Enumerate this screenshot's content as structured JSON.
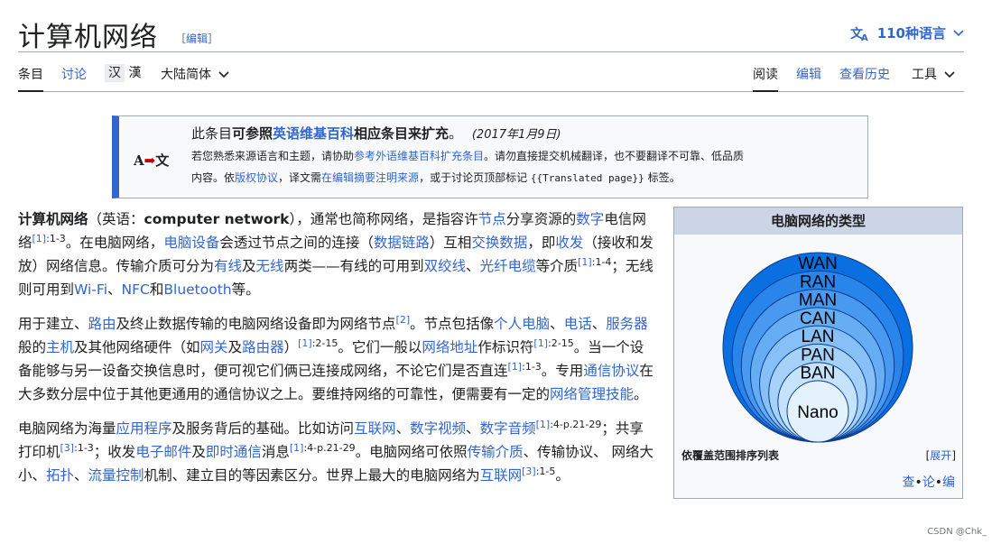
{
  "header": {
    "title": "计算机网络",
    "edit_open": "［",
    "edit_label": "编辑",
    "edit_close": "］",
    "languages": "110种语言"
  },
  "tabs": {
    "article": "条目",
    "talk": "讨论",
    "variant_trad": "汉",
    "variant_simp": "漢",
    "variant_select": "大陆简体",
    "read": "阅读",
    "edit": "编辑",
    "history": "查看历史",
    "tools": "工具"
  },
  "notice": {
    "icon": "A➡文",
    "l1_a": "此条目",
    "l1_b": "可参照",
    "l1_link": "英语维基百科",
    "l1_c": "相应条目来扩充",
    "l1_d": "。",
    "l1_date": "(2017年1月9日)",
    "l2_a": "若您熟悉来源语言和主题，请协助",
    "l2_link": "参考外语维基百科扩充条目",
    "l2_b": "。请勿直接提交机械翻译，也不要翻译不可靠、低品质",
    "l3_a": "内容。依",
    "l3_link1": "版权协议",
    "l3_b": "，译文需",
    "l3_link2": "在编辑摘要注明来源",
    "l3_c": "，或于讨论页顶部标记",
    "l3_code": "{{Translated page}}",
    "l3_d": "标签。"
  },
  "p1": {
    "t1": "计算机网络",
    "t2": "（英语：",
    "t3": "computer network",
    "t4": "），通常也简称网络，是指容许",
    "l1": "节点",
    "t5": "分享资源的",
    "l2": "数字",
    "t6": "电信网络",
    "s1": "[1]",
    "r1": ":1-3",
    "t7": "。在电脑网络，",
    "l3": "电脑设备",
    "t8": "会透过节点之间的连接（",
    "l4": "数据链路",
    "t9": "）互相",
    "l5": "交换数据",
    "t10": "，即",
    "l6": "收发",
    "t11": "（接收和发放）网络信息。传输介质可分为",
    "l7": "有线",
    "t12": "及",
    "l8": "无线",
    "t13": "两类——有线的可用到",
    "l9": "双绞线",
    "t14": "、",
    "l10": "光纤电缆",
    "t15": "等介质",
    "s2": "[1]",
    "r2": ":1-4",
    "t16": "；无线则可用到",
    "l11": "Wi-Fi",
    "t17": "、",
    "l12": "NFC",
    "t18": "和",
    "l13": "Bluetooth",
    "t19": "等。"
  },
  "p2": {
    "t1": "用于建立、",
    "l1": "路由",
    "t2": "及终止数据传输的电脑网络设备即为网络节点",
    "s1": "[2]",
    "t3": "。节点包括像",
    "l2": "个人电脑",
    "t4": "、",
    "l3": "电话",
    "t5": "、",
    "l4": "服务器",
    "t6": "般的",
    "l5": "主机",
    "t7": "及其他网络硬件（如",
    "l6": "网关",
    "t8": "及",
    "l7": "路由器",
    "t9": "）",
    "s2": "[1]",
    "r2": ":2-15",
    "t10": "。它们一般以",
    "l8": "网络地址",
    "t11": "作标识符",
    "s3": "[1]",
    "r3": ":2-15",
    "t12": "。当一个设备能够与另一设备交换信息时，便可视它们俩已连接成网络，不论它们是否直连",
    "s4": "[1]",
    "r4": ":1-3",
    "t13": "。专用",
    "l9": "通信协议",
    "t14": "在大多数分层中位于其他更通用的通信协议之上。要维持网络的可靠性，便需要有一定的",
    "l10": "网络管理技能",
    "t15": "。"
  },
  "p3": {
    "t1": "电脑网络为海量",
    "l1": "应用程序",
    "t2": "及服务背后的基础。比如访问",
    "l2": "互联网",
    "t3": "、",
    "l3": "数字视频",
    "t4": "、",
    "l4": "数字音频",
    "s1": "[1]",
    "r1": ":4-p.21-29",
    "t5": "；共享打印机",
    "s2": "[3]",
    "r2": ":1-3",
    "t6": "；收发",
    "l5": "电子邮件",
    "t7": "及",
    "l6": "即时通信",
    "t8": "消息",
    "s3": "[1]",
    "r3": ":4-p.21-29",
    "t9": "。电脑网络可依照",
    "l7": "传输介质",
    "t10": "、传输协议、 网络大小、",
    "l8": "拓扑",
    "t11": "、",
    "l9": "流量控制",
    "t12": "机制、建立目的等因素区分。世界上最大的电脑网络为",
    "l10": "互联网",
    "s4": "[3]",
    "r4": ":1-5",
    "t13": "。"
  },
  "infobox": {
    "title": "电脑网络的类型",
    "rings": [
      "WAN",
      "RAN",
      "MAN",
      "CAN",
      "LAN",
      "PAN",
      "BAN",
      "Nano"
    ],
    "colors": [
      "#0a6fe0",
      "#2985ea",
      "#4899ef",
      "#67adf3",
      "#86c0f6",
      "#a6d2f9",
      "#c5e3fc",
      "#e4f2fe"
    ],
    "footer_label": "依覆盖范围排序列表",
    "expand_open": "[",
    "expand": "展开",
    "expand_close": "]",
    "nav_v": "查",
    "nav_dot1": "•",
    "nav_t": "论",
    "nav_dot2": "•",
    "nav_e": "编"
  },
  "watermark": "CSDN @Chk_"
}
